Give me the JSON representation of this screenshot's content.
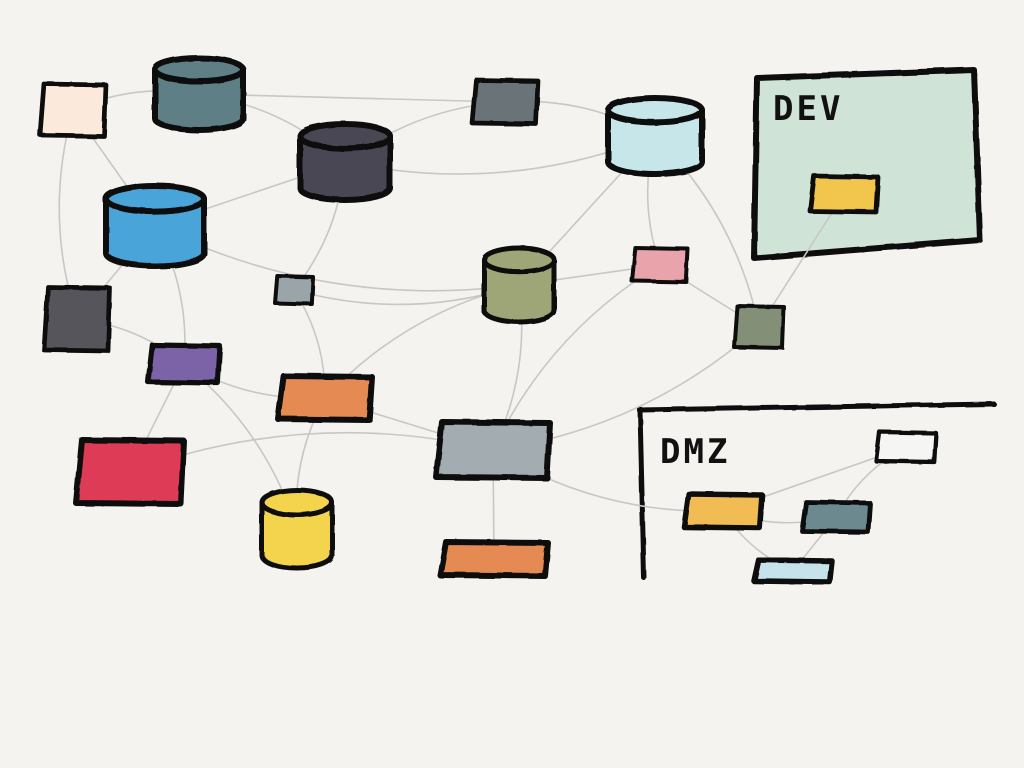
{
  "zones": [
    {
      "id": "dev",
      "label": "DEV",
      "fill": "#cfe3d6"
    },
    {
      "id": "dmz",
      "label": "DMZ",
      "fill": "none"
    }
  ],
  "colors": {
    "background": "#f4f3ef",
    "outline": "#111111",
    "connector": "#c7c7c7"
  },
  "nodes": [
    {
      "id": "n1",
      "kind": "server",
      "color": "#fbeadb"
    },
    {
      "id": "n2",
      "kind": "database",
      "color": "#5d7f85"
    },
    {
      "id": "n3",
      "kind": "server",
      "color": "#6a7378"
    },
    {
      "id": "n4",
      "kind": "database",
      "color": "#c7e6ea"
    },
    {
      "id": "n5",
      "kind": "database",
      "color": "#4a4752"
    },
    {
      "id": "n6",
      "kind": "database",
      "color": "#4aa5d9"
    },
    {
      "id": "n7",
      "kind": "server",
      "color": "#f2c64e"
    },
    {
      "id": "n8",
      "kind": "server",
      "color": "#9aa5a9"
    },
    {
      "id": "n9",
      "kind": "database",
      "color": "#9ea577"
    },
    {
      "id": "n10",
      "kind": "server",
      "color": "#e9a3aa"
    },
    {
      "id": "n11",
      "kind": "server",
      "color": "#56545c"
    },
    {
      "id": "n12",
      "kind": "server",
      "color": "#838f77"
    },
    {
      "id": "n13",
      "kind": "server",
      "color": "#7c63a8"
    },
    {
      "id": "n14",
      "kind": "server",
      "color": "#e58a52"
    },
    {
      "id": "n15",
      "kind": "server",
      "color": "#a3adb1"
    },
    {
      "id": "n16",
      "kind": "server",
      "color": "#dd3b57"
    },
    {
      "id": "n17",
      "kind": "database",
      "color": "#f4d44e"
    },
    {
      "id": "n18",
      "kind": "server",
      "color": "#e58a52"
    },
    {
      "id": "n19",
      "kind": "server",
      "color": "#f5f5f3"
    },
    {
      "id": "n20",
      "kind": "server",
      "color": "#f2bc55"
    },
    {
      "id": "n21",
      "kind": "server",
      "color": "#6d8990"
    },
    {
      "id": "n22",
      "kind": "server",
      "color": "#c6e3ec"
    }
  ],
  "edges": [
    [
      "n1",
      "n2"
    ],
    [
      "n1",
      "n6"
    ],
    [
      "n1",
      "n11"
    ],
    [
      "n2",
      "n5"
    ],
    [
      "n2",
      "n3"
    ],
    [
      "n3",
      "n5"
    ],
    [
      "n3",
      "n4"
    ],
    [
      "n5",
      "n6"
    ],
    [
      "n5",
      "n4"
    ],
    [
      "n5",
      "n8"
    ],
    [
      "n6",
      "n11"
    ],
    [
      "n6",
      "n9"
    ],
    [
      "n6",
      "n13"
    ],
    [
      "n4",
      "n9"
    ],
    [
      "n4",
      "n10"
    ],
    [
      "n4",
      "n12"
    ],
    [
      "n7",
      "n12"
    ],
    [
      "n8",
      "n9"
    ],
    [
      "n8",
      "n14"
    ],
    [
      "n9",
      "n10"
    ],
    [
      "n9",
      "n14"
    ],
    [
      "n9",
      "n15"
    ],
    [
      "n10",
      "n12"
    ],
    [
      "n10",
      "n15"
    ],
    [
      "n11",
      "n13"
    ],
    [
      "n13",
      "n16"
    ],
    [
      "n13",
      "n14"
    ],
    [
      "n13",
      "n17"
    ],
    [
      "n14",
      "n15"
    ],
    [
      "n14",
      "n17"
    ],
    [
      "n16",
      "n15"
    ],
    [
      "n15",
      "n18"
    ],
    [
      "n15",
      "n20"
    ],
    [
      "n12",
      "n15"
    ],
    [
      "n20",
      "n19"
    ],
    [
      "n20",
      "n22"
    ],
    [
      "n21",
      "n19"
    ],
    [
      "n21",
      "n22"
    ],
    [
      "n20",
      "n21"
    ]
  ]
}
